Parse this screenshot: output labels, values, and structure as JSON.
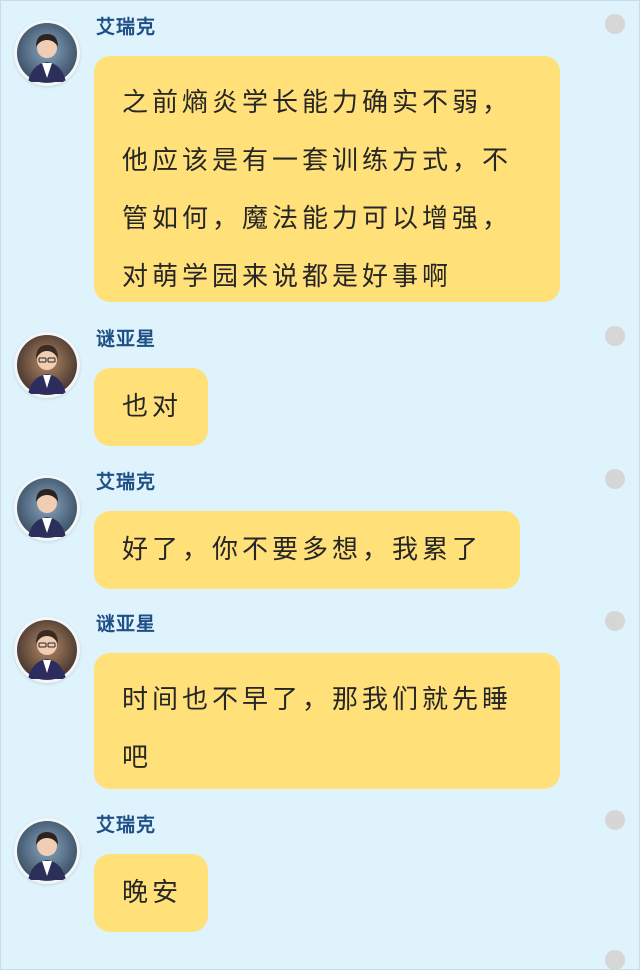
{
  "messages": [
    {
      "sender": "艾瑞克",
      "avatar": "eric-avatar",
      "text": "之前熵炎学长能力确实不弱，\n他应该是有一套训练方式，不\n管如何，魔法能力可以增强，\n对萌学园来说都是好事啊"
    },
    {
      "sender": "谜亚星",
      "avatar": "miyaxing-avatar",
      "text": "也对"
    },
    {
      "sender": "艾瑞克",
      "avatar": "eric-avatar",
      "text": "好了，你不要多想，我累了"
    },
    {
      "sender": "谜亚星",
      "avatar": "miyaxing-avatar",
      "text": "时间也不早了，那我们就先睡\n吧"
    },
    {
      "sender": "艾瑞克",
      "avatar": "eric-avatar",
      "text": "晚安"
    }
  ],
  "colors": {
    "background": "#dff3fd",
    "bubble": "#ffe079",
    "sender_name": "#1f4f86",
    "dot": "#d6d6d6"
  },
  "icons": {
    "status_dot": "circle-dot-icon"
  }
}
